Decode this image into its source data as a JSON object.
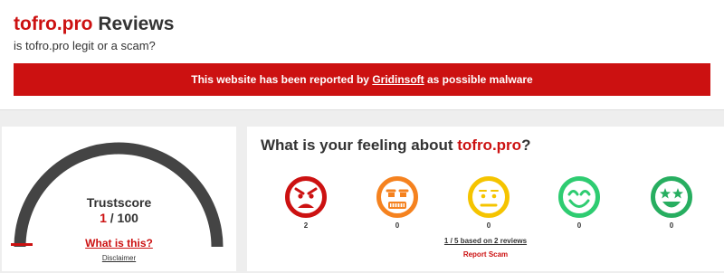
{
  "header": {
    "site_name": "tofro.pro",
    "title_suffix": " Reviews",
    "subtitle": "is tofro.pro legit or a scam?"
  },
  "banner": {
    "text_before": "This website has been reported by ",
    "link": "Gridinsoft",
    "text_after": " as possible malware",
    "color": "#cc1111"
  },
  "trustscore": {
    "label": "Trustscore",
    "value": "1",
    "max": " / 100",
    "what_link": "What is this?",
    "disclaimer": "Disclaimer",
    "gauge_fraction": 0.01,
    "gauge_color": "#444444",
    "marker_color": "#cc1111"
  },
  "feeling": {
    "title_prefix": "What is your feeling about ",
    "site": "tofro.pro",
    "title_suffix": "?",
    "emojis": [
      {
        "name": "angry-icon",
        "color": "#cc1111",
        "count": "2"
      },
      {
        "name": "annoyed-icon",
        "color": "#f5821f",
        "count": "0"
      },
      {
        "name": "neutral-icon",
        "color": "#f5c400",
        "count": "0"
      },
      {
        "name": "smile-icon",
        "color": "#2ecc71",
        "count": "0"
      },
      {
        "name": "star-eyes-icon",
        "color": "#27ae60",
        "count": "0"
      }
    ],
    "rating_text": "1 / 5 based on 2 reviews",
    "report_label": "Report Scam"
  }
}
